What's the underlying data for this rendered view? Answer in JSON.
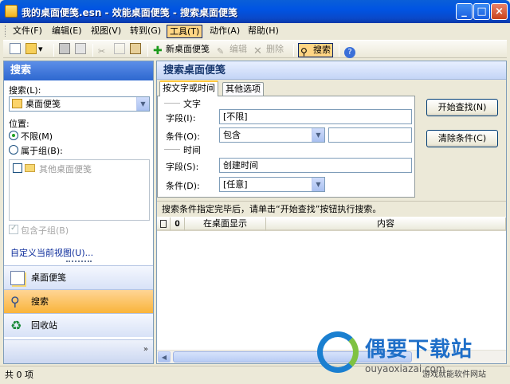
{
  "window": {
    "title": "我的桌面便笺.esn - 效能桌面便笺 - 搜索桌面便笺"
  },
  "menu": [
    {
      "label": "文件(F)"
    },
    {
      "label": "编辑(E)"
    },
    {
      "label": "视图(V)"
    },
    {
      "label": "转到(G)"
    },
    {
      "label": "工具(T)"
    },
    {
      "label": "动作(A)"
    },
    {
      "label": "帮助(H)"
    }
  ],
  "toolbar": {
    "new_note": "新桌面便笺",
    "edit": "编辑",
    "delete": "删除",
    "search": "搜索"
  },
  "left": {
    "title": "搜索",
    "search_label": "搜索(L):",
    "search_value": "桌面便笺",
    "location_label": "位置:",
    "radio_unlimited": "不限(M)",
    "radio_group": "属于组(B):",
    "tree_item": "其他桌面便笺",
    "include_sub": "包含子组(B)",
    "customize_link": "自定义当前视图(U)...",
    "nav": [
      {
        "label": "桌面便笺"
      },
      {
        "label": "搜索"
      },
      {
        "label": "回收站"
      }
    ]
  },
  "right": {
    "title": "搜索桌面便笺",
    "tabs": [
      {
        "label": "按文字或时间"
      },
      {
        "label": "其他选项"
      }
    ],
    "text_group": "文字",
    "field_label": "字段(I):",
    "field_value": "[不限]",
    "cond_label": "条件(O):",
    "cond_value": "包含",
    "cond_text": "",
    "time_group": "时间",
    "time_field_label": "字段(S):",
    "time_field_value": "创建时间",
    "time_cond_label": "条件(D):",
    "time_cond_value": "[任意]",
    "start_button": "开始查找(N)",
    "clear_button": "清除条件(C)",
    "hint": "搜索条件指定完毕后，请单击“开始查找”按钮执行搜索。",
    "columns": [
      "",
      "",
      "在桌面显示",
      "内容"
    ]
  },
  "status": {
    "text": "共 0 项"
  },
  "watermark": {
    "name": "偶要下载站",
    "url": "ouyaoxiazai.com",
    "tag": "游戏就能软件网站"
  }
}
